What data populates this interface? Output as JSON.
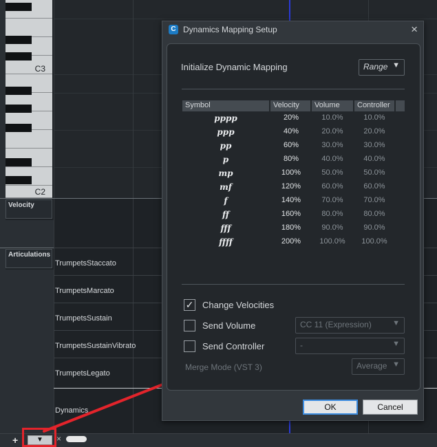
{
  "editor": {
    "keyboard": {
      "c3_label": "C3",
      "c2_label": "C2"
    },
    "lanes": {
      "velocity_label": "Velocity",
      "articulations_label": "Articulations"
    },
    "articulations": [
      "TrumpetsStaccato",
      "TrumpetsMarcato",
      "TrumpetsSustain",
      "TrumpetsSustainVibrato",
      "TrumpetsLegato"
    ],
    "dynamics_label": "Dynamics",
    "bottom_bar": {
      "plus": "+",
      "arrow": "▼",
      "close": "×"
    }
  },
  "dialog": {
    "title": "Dynamics Mapping Setup",
    "close_icon": "×",
    "app_icon": "C",
    "init_label": "Initialize Dynamic Mapping",
    "range_value": "Range",
    "table": {
      "headers": [
        "Symbol",
        "Velocity",
        "Volume",
        "Controller"
      ],
      "rows": [
        {
          "symbol": "pppp",
          "velocity": "20%",
          "volume": "10.0%",
          "controller": "10.0%"
        },
        {
          "symbol": "ppp",
          "velocity": "40%",
          "volume": "20.0%",
          "controller": "20.0%"
        },
        {
          "symbol": "pp",
          "velocity": "60%",
          "volume": "30.0%",
          "controller": "30.0%"
        },
        {
          "symbol": "p",
          "velocity": "80%",
          "volume": "40.0%",
          "controller": "40.0%"
        },
        {
          "symbol": "mp",
          "velocity": "100%",
          "volume": "50.0%",
          "controller": "50.0%"
        },
        {
          "symbol": "mf",
          "velocity": "120%",
          "volume": "60.0%",
          "controller": "60.0%"
        },
        {
          "symbol": "f",
          "velocity": "140%",
          "volume": "70.0%",
          "controller": "70.0%"
        },
        {
          "symbol": "ff",
          "velocity": "160%",
          "volume": "80.0%",
          "controller": "80.0%"
        },
        {
          "symbol": "fff",
          "velocity": "180%",
          "volume": "90.0%",
          "controller": "90.0%"
        },
        {
          "symbol": "ffff",
          "velocity": "200%",
          "volume": "100.0%",
          "controller": "100.0%"
        }
      ]
    },
    "options": {
      "change_velocities": {
        "label": "Change Velocities",
        "checked": true,
        "mark": "✓"
      },
      "send_volume": {
        "label": "Send Volume",
        "checked": false,
        "value": "CC 11 (Expression)"
      },
      "send_controller": {
        "label": "Send Controller",
        "checked": false,
        "value": "-"
      },
      "merge_mode": {
        "label": "Merge Mode (VST 3)",
        "value": "Average"
      }
    },
    "buttons": {
      "ok": "OK",
      "cancel": "Cancel"
    },
    "caret": "▼"
  },
  "colors": {
    "accent": "#3e8de0",
    "annotation": "#e3242b",
    "playhead": "#2b3bd8"
  }
}
